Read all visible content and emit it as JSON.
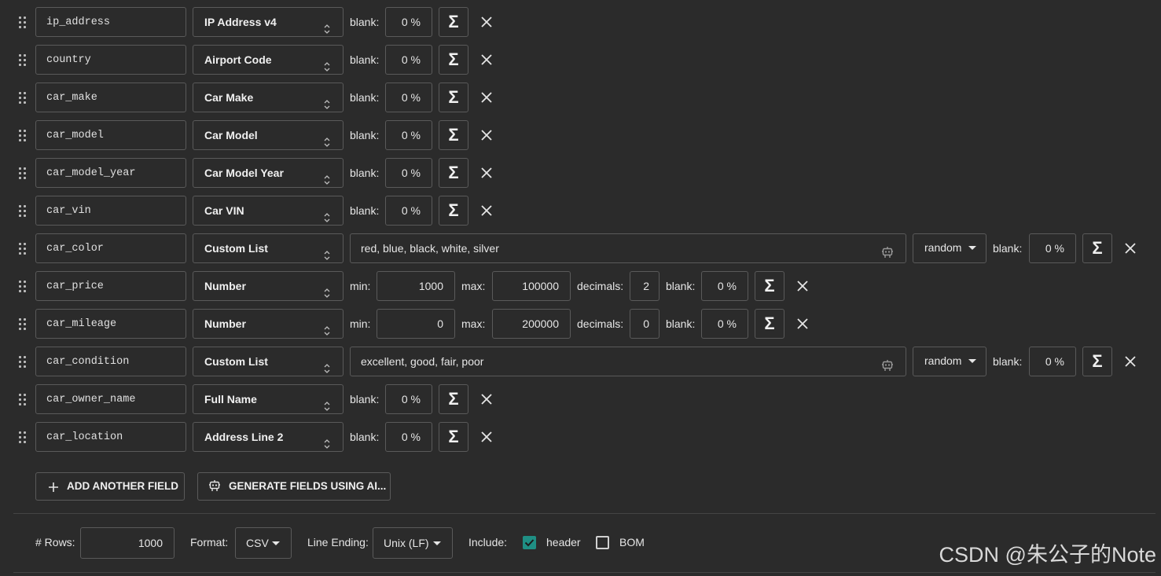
{
  "labels": {
    "blank": "blank:",
    "min": "min:",
    "max": "max:",
    "decimals": "decimals:",
    "sigma": "Σ"
  },
  "fields": [
    {
      "name": "ip_address",
      "type": "IP Address v4",
      "blank": "0 %"
    },
    {
      "name": "country",
      "type": "Airport Code",
      "blank": "0 %"
    },
    {
      "name": "car_make",
      "type": "Car Make",
      "blank": "0 %"
    },
    {
      "name": "car_model",
      "type": "Car Model",
      "blank": "0 %"
    },
    {
      "name": "car_model_year",
      "type": "Car Model Year",
      "blank": "0 %"
    },
    {
      "name": "car_vin",
      "type": "Car VIN",
      "blank": "0 %"
    },
    {
      "name": "car_color",
      "type": "Custom List",
      "values": "red, blue, black, white, silver",
      "order": "random",
      "blank": "0 %"
    },
    {
      "name": "car_price",
      "type": "Number",
      "min": "1000",
      "max": "100000",
      "decimals": "2",
      "blank": "0 %"
    },
    {
      "name": "car_mileage",
      "type": "Number",
      "min": "0",
      "max": "200000",
      "decimals": "0",
      "blank": "0 %"
    },
    {
      "name": "car_condition",
      "type": "Custom List",
      "values": "excellent, good, fair, poor",
      "order": "random",
      "blank": "0 %"
    },
    {
      "name": "car_owner_name",
      "type": "Full Name",
      "blank": "0 %"
    },
    {
      "name": "car_location",
      "type": "Address Line 2",
      "blank": "0 %"
    }
  ],
  "buttons": {
    "add_field": "ADD ANOTHER FIELD",
    "generate_ai": "GENERATE FIELDS USING AI..."
  },
  "footer": {
    "rows_label": "# Rows:",
    "rows_value": "1000",
    "format_label": "Format:",
    "format_value": "CSV",
    "line_ending_label": "Line Ending:",
    "line_ending_value": "Unix (LF)",
    "include_label": "Include:",
    "header_label": "header",
    "header_checked": true,
    "bom_label": "BOM",
    "bom_checked": false
  },
  "watermark": "CSDN @朱公子的Note",
  "colors": {
    "background": "#2b2b2b",
    "border": "#5a5a5a",
    "checkbox_accent": "#1f8f84"
  }
}
